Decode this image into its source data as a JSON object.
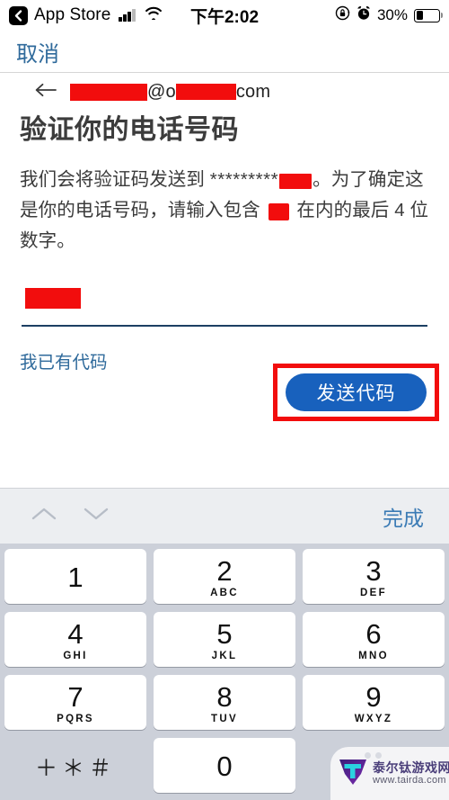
{
  "status_bar": {
    "back_icon": "back-chevron-icon",
    "carrier_app": "App Store",
    "signal_icon": "cellular-signal-icon",
    "wifi_icon": "wifi-icon",
    "time": "下午2:02",
    "rotation_lock_icon": "rotation-lock-icon",
    "alarm_icon": "alarm-clock-icon",
    "battery_percent": "30%",
    "battery_level": 30
  },
  "nav": {
    "cancel_label": "取消"
  },
  "account": {
    "back_icon": "back-arrow-icon",
    "email_domain_suffix": "com",
    "email_at": "@",
    "email_domain_visible": "o",
    "email_user_redacted": true,
    "email_domain_redacted": true
  },
  "main": {
    "title": "验证你的电话号码",
    "body_part1": "我们会将验证码发送到 ",
    "body_stars": "*********",
    "body_part2": "。为了确定这是你的电话号码，请输入包含 ",
    "body_part3": " 在内的最后 4 位数字。",
    "input": {
      "value_redacted": true,
      "placeholder": ""
    },
    "have_code_link": "我已有代码",
    "send_button_label": "发送代码"
  },
  "annotation": {
    "highlight_color": "#f20d0d",
    "target": "send-code-button"
  },
  "colors": {
    "link_blue": "#2f6a9b",
    "button_blue": "#1861bd",
    "redaction_red": "#f20d0d",
    "keyboard_bg": "#ccd0d9",
    "accessory_bg": "#eceef1",
    "underline_navy": "#1c3f63"
  },
  "keyboard": {
    "accessory": {
      "prev_icon": "chevron-up-icon",
      "next_icon": "chevron-down-icon",
      "done_label": "完成"
    },
    "rows": [
      [
        {
          "digit": "1",
          "letters": ""
        },
        {
          "digit": "2",
          "letters": "ABC"
        },
        {
          "digit": "3",
          "letters": "DEF"
        }
      ],
      [
        {
          "digit": "4",
          "letters": "GHI"
        },
        {
          "digit": "5",
          "letters": "JKL"
        },
        {
          "digit": "6",
          "letters": "MNO"
        }
      ],
      [
        {
          "digit": "7",
          "letters": "PQRS"
        },
        {
          "digit": "8",
          "letters": "TUV"
        },
        {
          "digit": "9",
          "letters": "WXYZ"
        }
      ],
      [
        {
          "digit": "＋＊＃",
          "letters": "",
          "symbol": true
        },
        {
          "digit": "0",
          "letters": ""
        },
        {
          "digit": "",
          "letters": "",
          "blank": true
        }
      ]
    ]
  },
  "watermark": {
    "logo_icon": "t-logo-icon",
    "title": "泰尔钛游戏网",
    "url": "www.tairda.com"
  }
}
